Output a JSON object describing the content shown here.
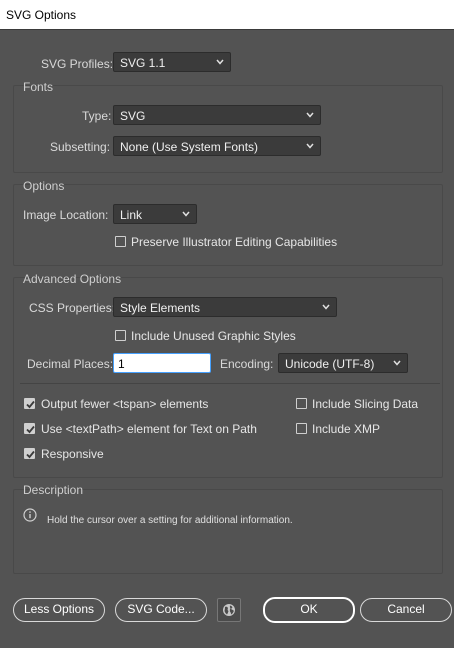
{
  "window": {
    "title": "SVG Options"
  },
  "profiles": {
    "label": "SVG Profiles:",
    "value": "SVG 1.1"
  },
  "fonts": {
    "title": "Fonts",
    "type_label": "Type:",
    "type_value": "SVG",
    "subsetting_label": "Subsetting:",
    "subsetting_value": "None (Use System Fonts)"
  },
  "options": {
    "title": "Options",
    "image_location_label": "Image Location:",
    "image_location_value": "Link",
    "preserve_label": "Preserve Illustrator Editing Capabilities",
    "preserve_checked": false
  },
  "advanced": {
    "title": "Advanced Options",
    "css_label": "CSS Properties:",
    "css_value": "Style Elements",
    "unused_styles_label": "Include Unused Graphic Styles",
    "unused_styles_checked": false,
    "decimal_label": "Decimal Places:",
    "decimal_value": "1",
    "encoding_label": "Encoding:",
    "encoding_value": "Unicode (UTF-8)",
    "tspan_label": "Output fewer <tspan> elements",
    "tspan_checked": true,
    "textpath_label": "Use <textPath> element for Text on Path",
    "textpath_checked": true,
    "responsive_label": "Responsive",
    "responsive_checked": true,
    "slicing_label": "Include Slicing Data",
    "slicing_checked": false,
    "xmp_label": "Include XMP",
    "xmp_checked": false
  },
  "description": {
    "title": "Description",
    "text": "Hold the cursor over a setting for additional information."
  },
  "buttons": {
    "less_options": "Less Options",
    "svg_code": "SVG Code...",
    "ok": "OK",
    "cancel": "Cancel"
  },
  "icons": {
    "chevron": "chevron-down-icon",
    "info": "info-icon",
    "globe": "globe-icon",
    "check": "checkmark-icon"
  }
}
